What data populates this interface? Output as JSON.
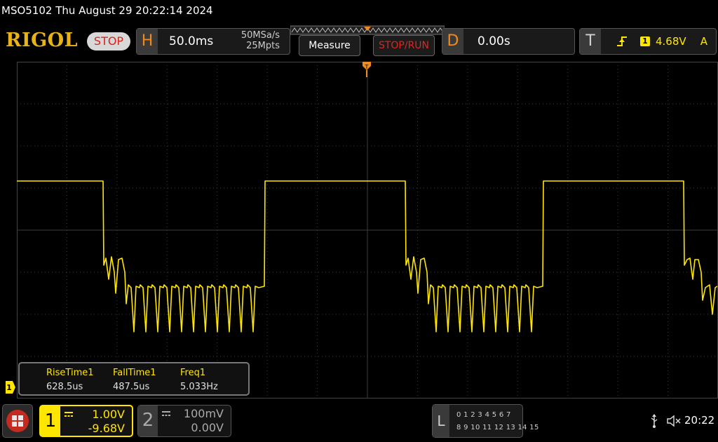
{
  "header": {
    "title_line": "MSO5102  Thu August 29 20:22:14 2024",
    "logo": "RIGOL",
    "run_state": "STOP"
  },
  "horizontal": {
    "letter": "H",
    "timebase": "50.0ms",
    "sample_rate": "50MSa/s",
    "memory_depth": "25Mpts"
  },
  "buttons": {
    "measure": "Measure",
    "stop_run": "STOP/RUN"
  },
  "delay": {
    "letter": "D",
    "value": "0.00s"
  },
  "trigger": {
    "letter": "T",
    "source": "1",
    "level": "4.68V",
    "mode": "A"
  },
  "measurements": [
    {
      "name": "RiseTime1",
      "value": "628.5us"
    },
    {
      "name": "FallTime1",
      "value": "487.5us"
    },
    {
      "name": "Freq1",
      "value": "5.033Hz"
    }
  ],
  "channels": [
    {
      "number": "1",
      "scale": "1.00V",
      "offset": "-9.68V",
      "active": true
    },
    {
      "number": "2",
      "scale": "100mV",
      "offset": "0.00V",
      "active": false
    }
  ],
  "logic_analyzer": {
    "letter": "L",
    "row1": "0 1 2 3   4 5 6 7",
    "row2": "8  9 10 11  12 13 14 15"
  },
  "status": {
    "time": "20:22"
  },
  "colors": {
    "ch1": "#ffe600",
    "accent_orange": "#f08a1c",
    "stop_red": "#d5241c",
    "logo_gold": "#e7b21a",
    "grid": "#3c3c3c"
  },
  "icons": {
    "menu": "menu-grid-icon",
    "usb": "usb-icon",
    "speaker": "speaker-muted-icon",
    "trigger_edge": "rising-edge-icon",
    "trigger_marker": "trigger-position-icon"
  }
}
